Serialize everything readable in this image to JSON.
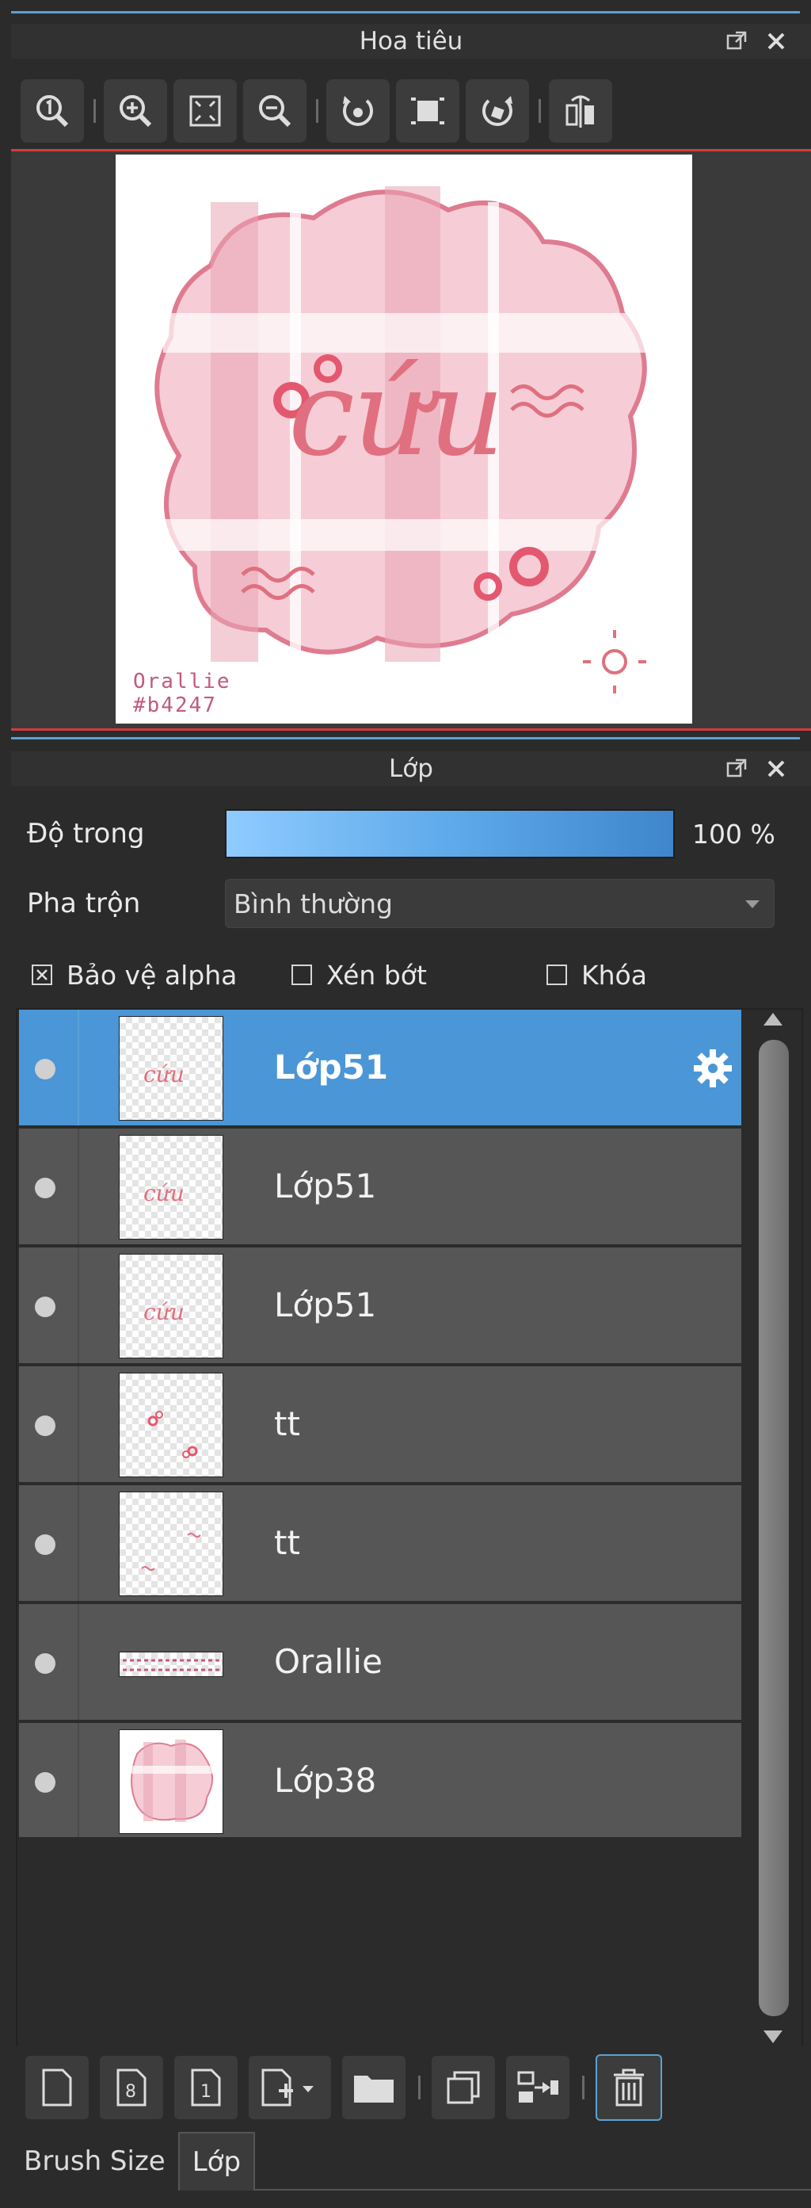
{
  "navigator": {
    "title": "Hoa tiêu",
    "toolbar": [
      {
        "icon": "zoom-100-icon"
      },
      {
        "icon": "zoom-in-icon"
      },
      {
        "icon": "fit-window-icon"
      },
      {
        "icon": "zoom-out-icon"
      },
      {
        "icon": "rotate-left-icon"
      },
      {
        "icon": "reset-view-icon"
      },
      {
        "icon": "rotate-right-icon"
      },
      {
        "icon": "flip-horizontal-icon"
      }
    ],
    "preview": {
      "canvas_text": "cứu",
      "signature_line1": "Orallie",
      "signature_line2": "#b4247"
    }
  },
  "layers_panel": {
    "title": "Lớp",
    "opacity_label": "Độ trong",
    "opacity_value": "100 %",
    "opacity_fraction": 1.0,
    "blend_label": "Pha trộn",
    "blend_value": "Bình thường",
    "protect_alpha": {
      "label": "Bảo vệ alpha",
      "checked": true
    },
    "clipping": {
      "label": "Xén bớt",
      "checked": false
    },
    "lock": {
      "label": "Khóa",
      "checked": false
    },
    "layers": [
      {
        "name": "Lớp51",
        "selected": true,
        "thumb": "text"
      },
      {
        "name": "Lớp51",
        "selected": false,
        "thumb": "text"
      },
      {
        "name": "Lớp51",
        "selected": false,
        "thumb": "text"
      },
      {
        "name": "tt",
        "selected": false,
        "thumb": "dots"
      },
      {
        "name": "tt",
        "selected": false,
        "thumb": "waves"
      },
      {
        "name": "Orallie",
        "selected": false,
        "thumb": "signature"
      },
      {
        "name": "Lớp38",
        "selected": false,
        "thumb": "background"
      }
    ],
    "bottom_toolbar": [
      {
        "icon": "new-layer-icon"
      },
      {
        "icon": "new-8bit-layer-icon"
      },
      {
        "icon": "new-1bit-layer-icon"
      },
      {
        "icon": "add-layer-menu-icon"
      },
      {
        "icon": "new-folder-icon"
      },
      {
        "icon": "duplicate-layer-icon"
      },
      {
        "icon": "merge-down-icon"
      },
      {
        "icon": "delete-layer-icon"
      }
    ]
  },
  "tabs": [
    {
      "label": "Brush Size",
      "active": false
    },
    {
      "label": "Lớp",
      "active": true
    }
  ],
  "colors": {
    "accent": "#4a96d6",
    "pink": "#e0707f",
    "border_red": "#d23c3c"
  }
}
